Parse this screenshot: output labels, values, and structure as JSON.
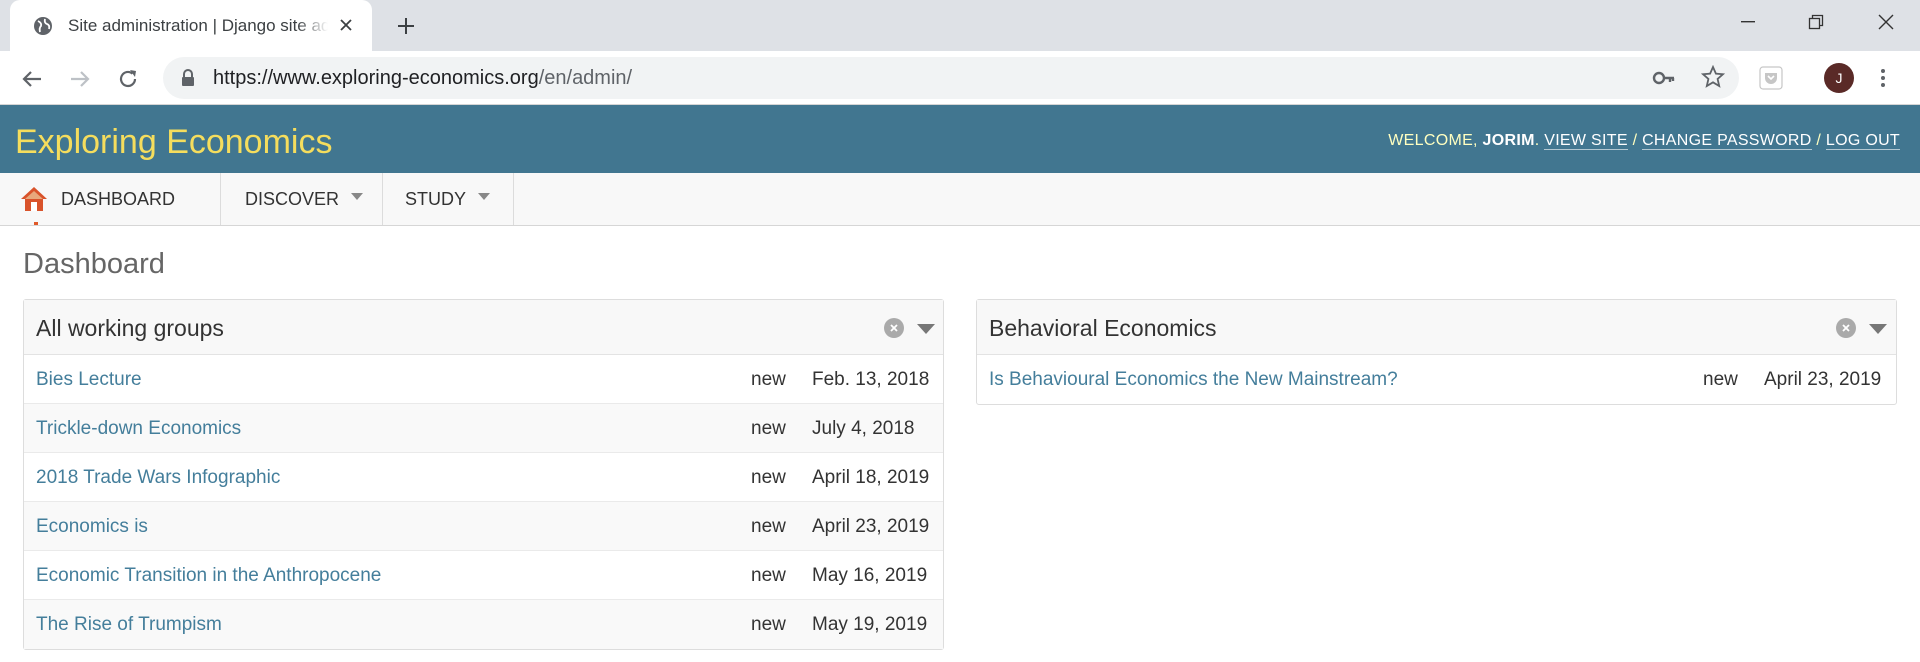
{
  "browser": {
    "tab_title": "Site administration | Django site admin",
    "url_host": "https://www.exploring-economics.org",
    "url_path": "/en/admin/",
    "avatar_initial": "J"
  },
  "header": {
    "site_name": "Exploring Economics",
    "welcome_prefix": "WELCOME, ",
    "username": "JORIM",
    "welcome_suffix": ". ",
    "view_site": "VIEW SITE",
    "separator": " / ",
    "change_password": "CHANGE PASSWORD",
    "log_out": "LOG OUT"
  },
  "menu": {
    "items": [
      {
        "label": "DASHBOARD"
      },
      {
        "label": "DISCOVER"
      },
      {
        "label": "STUDY"
      }
    ]
  },
  "page": {
    "title": "Dashboard"
  },
  "modules": [
    {
      "title": "All working groups",
      "rows": [
        {
          "name": "Bies Lecture",
          "status": "new",
          "date": "Feb. 13, 2018"
        },
        {
          "name": "Trickle-down Economics",
          "status": "new",
          "date": "July 4, 2018"
        },
        {
          "name": "2018 Trade Wars Infographic",
          "status": "new",
          "date": "April 18, 2019"
        },
        {
          "name": "Economics is",
          "status": "new",
          "date": "April 23, 2019"
        },
        {
          "name": "Economic Transition in the Anthropocene",
          "status": "new",
          "date": "May 16, 2019"
        },
        {
          "name": "The Rise of Trumpism",
          "status": "new",
          "date": "May 19, 2019"
        }
      ]
    },
    {
      "title": "Behavioral Economics",
      "rows": [
        {
          "name": "Is Behavioural Economics the New Mainstream?",
          "status": "new",
          "date": "April 23, 2019"
        }
      ]
    }
  ],
  "colors": {
    "header_bg": "#417690",
    "site_name": "#f5dd5d",
    "link": "#447e9b"
  }
}
